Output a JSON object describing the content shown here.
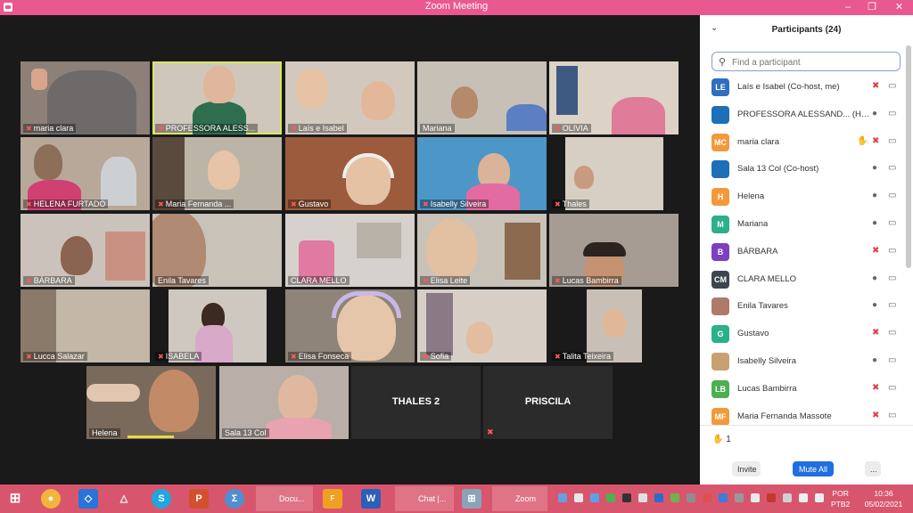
{
  "window": {
    "title": "Zoom Meeting"
  },
  "video": {
    "tiles": [
      {
        "name": "maria clara",
        "muted": true
      },
      {
        "name": "PROFESSORA ALESS...",
        "muted": true
      },
      {
        "name": "Laís e Isabel",
        "muted": true
      },
      {
        "name": "Mariana",
        "muted": false
      },
      {
        "name": "OLIVIA",
        "muted": true
      },
      {
        "name": "HELENA FURTADO",
        "muted": true
      },
      {
        "name": "Maria Fernanda ...",
        "muted": true
      },
      {
        "name": "Gustavo",
        "muted": true
      },
      {
        "name": "Isabelly Silveira",
        "muted": true
      },
      {
        "name": "Thales",
        "muted": true
      },
      {
        "name": "BÁRBARA",
        "muted": true
      },
      {
        "name": "Enila Tavares",
        "muted": false
      },
      {
        "name": "CLARA MELLO",
        "muted": false
      },
      {
        "name": "Elisa Leite",
        "muted": true
      },
      {
        "name": "Lucas Bambirra",
        "muted": true
      },
      {
        "name": "Lucca Salazar",
        "muted": true
      },
      {
        "name": "ISABELA",
        "muted": true
      },
      {
        "name": "Elisa Fonseca",
        "muted": true
      },
      {
        "name": "Sofia",
        "muted": true
      },
      {
        "name": "Talita Teixeira",
        "muted": true
      },
      {
        "name": "Helena",
        "muted": false
      },
      {
        "name": "Sala 13 Col",
        "muted": false
      },
      {
        "name": "THALES 2",
        "muted": false
      },
      {
        "name": "PRISCILA",
        "muted": true
      }
    ]
  },
  "participants": {
    "title": "Participants (24)",
    "search_placeholder": "Find a participant",
    "list": [
      {
        "initials": "LE",
        "name": "Laís e Isabel (Co-host, me)",
        "color": "#2f6fc0",
        "status": "muted"
      },
      {
        "initials": "",
        "name": "PROFESSORA ALESSAND... (Host)",
        "color": "#1d6fb8",
        "status": "mic"
      },
      {
        "initials": "MC",
        "name": "maria clara",
        "color": "#f29a3a",
        "status": "hand"
      },
      {
        "initials": "",
        "name": "Sala 13 Col (Co-host)",
        "color": "#1d6fb8",
        "status": "mic"
      },
      {
        "initials": "H",
        "name": "Helena",
        "color": "#f29a3a",
        "status": "mic"
      },
      {
        "initials": "M",
        "name": "Mariana",
        "color": "#2bb08a",
        "status": "mic"
      },
      {
        "initials": "B",
        "name": "BÁRBARA",
        "color": "#7f3fbf",
        "status": "muted"
      },
      {
        "initials": "CM",
        "name": "CLARA MELLO",
        "color": "#3c4650",
        "status": "mic"
      },
      {
        "initials": "",
        "name": "Enila Tavares",
        "color": "#b07a6a",
        "status": "mic"
      },
      {
        "initials": "G",
        "name": "Gustavo",
        "color": "#2bb08a",
        "status": "muted"
      },
      {
        "initials": "",
        "name": "Isabelly Silveira",
        "color": "#c9a070",
        "status": "mic"
      },
      {
        "initials": "LB",
        "name": "Lucas Bambirra",
        "color": "#4caf50",
        "status": "muted"
      },
      {
        "initials": "MF",
        "name": "Maria Fernanda Massote",
        "color": "#f29a3a",
        "status": "muted"
      }
    ],
    "raised_count": "1",
    "invite_label": "Invite",
    "mute_all_label": "Mute All",
    "more_label": "..."
  },
  "taskbar": {
    "items": [
      {
        "label": "Docu..."
      },
      {
        "label": "Chat |..."
      },
      {
        "label": "Zoom"
      }
    ],
    "language": "POR",
    "layout": "PTB2",
    "time": "10:36",
    "date": "05/02/2021"
  }
}
